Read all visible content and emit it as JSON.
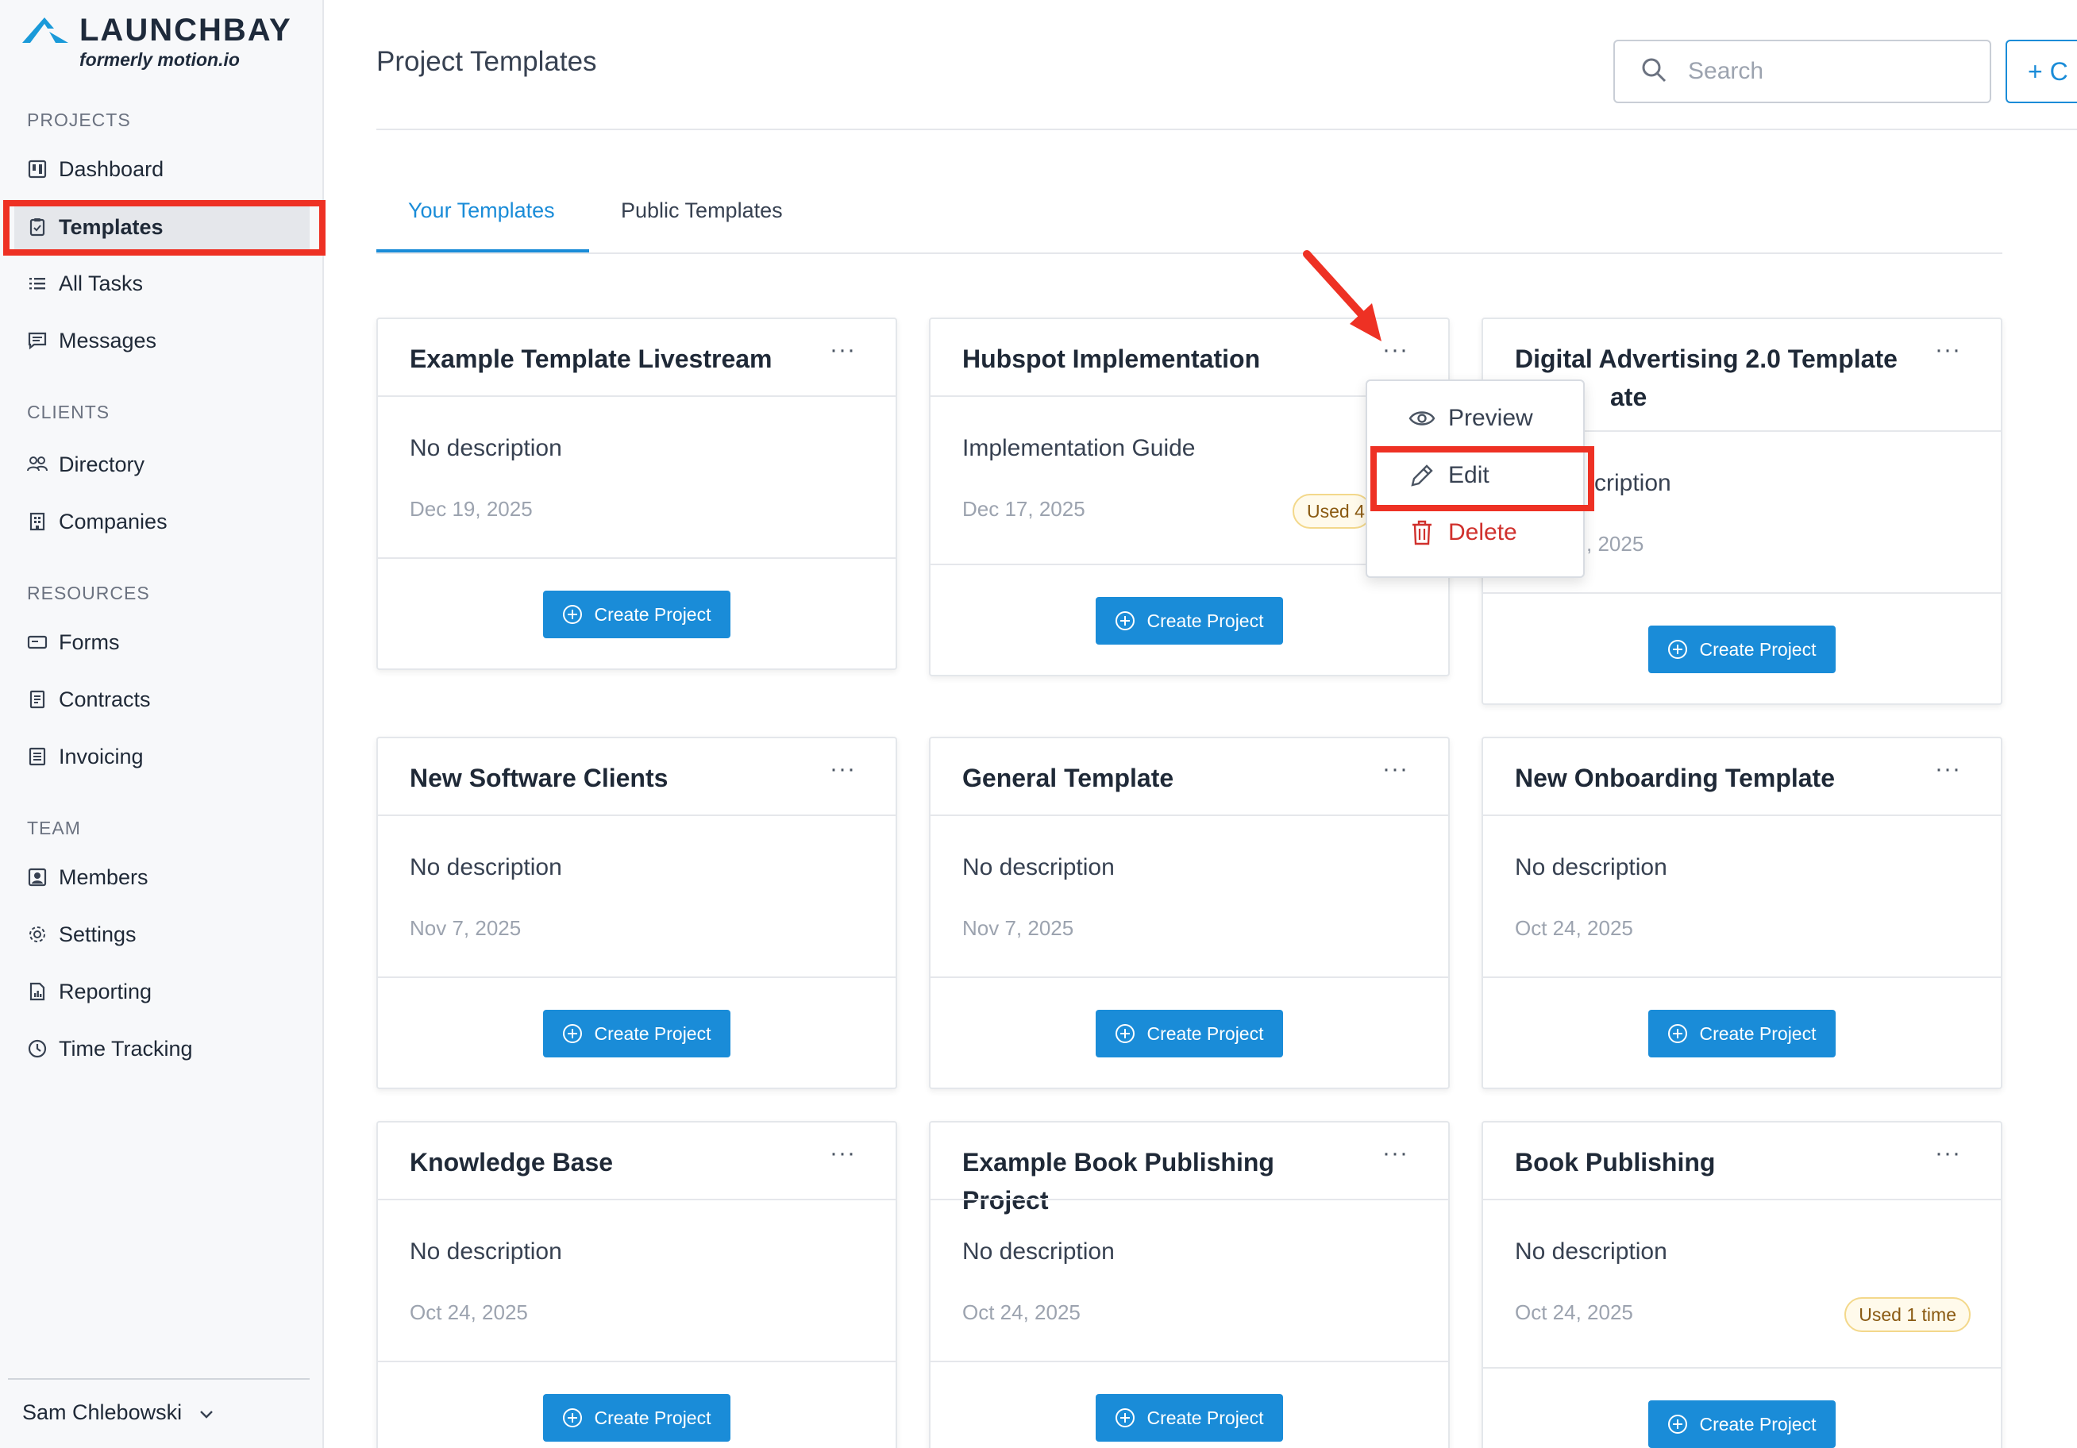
{
  "brand": {
    "name": "LAUNCHBAY",
    "tagline": "formerly motion.io",
    "color": "#1a8cd8"
  },
  "sidebar": {
    "sections": [
      {
        "label": "PROJECTS",
        "items": [
          {
            "label": "Dashboard",
            "icon": "dashboard-icon"
          },
          {
            "label": "Templates",
            "icon": "clipboard-icon",
            "active": true
          },
          {
            "label": "All Tasks",
            "icon": "list-icon"
          },
          {
            "label": "Messages",
            "icon": "message-icon"
          }
        ]
      },
      {
        "label": "CLIENTS",
        "items": [
          {
            "label": "Directory",
            "icon": "users-icon"
          },
          {
            "label": "Companies",
            "icon": "building-icon"
          }
        ]
      },
      {
        "label": "RESOURCES",
        "items": [
          {
            "label": "Forms",
            "icon": "form-icon"
          },
          {
            "label": "Contracts",
            "icon": "document-icon"
          },
          {
            "label": "Invoicing",
            "icon": "invoice-icon"
          }
        ]
      },
      {
        "label": "TEAM",
        "items": [
          {
            "label": "Members",
            "icon": "member-icon"
          },
          {
            "label": "Settings",
            "icon": "gear-icon"
          },
          {
            "label": "Reporting",
            "icon": "report-icon"
          },
          {
            "label": "Time Tracking",
            "icon": "clock-icon"
          }
        ]
      }
    ],
    "user": {
      "name": "Sam Chlebowski"
    }
  },
  "header": {
    "title": "Project Templates",
    "search_placeholder": "Search",
    "new_button_label": "+ C"
  },
  "tabs": [
    {
      "label": "Your Templates",
      "active": true
    },
    {
      "label": "Public Templates",
      "active": false
    }
  ],
  "templates": [
    {
      "title": "Example Template Livestream",
      "description": "No description",
      "date": "Dec 19, 2025",
      "badge": ""
    },
    {
      "title": "Hubspot Implementation",
      "description": "Implementation Guide",
      "date": "Dec 17, 2025",
      "badge": "Used 4 t"
    },
    {
      "title": "Digital Advertising 2.0 Template",
      "title_line2": "ate",
      "description": "cription",
      "date": ", 2025",
      "badge": ""
    },
    {
      "title": "New Software Clients",
      "description": "No description",
      "date": "Nov 7, 2025",
      "badge": ""
    },
    {
      "title": "General Template",
      "description": "No description",
      "date": "Nov 7, 2025",
      "badge": ""
    },
    {
      "title": "New Onboarding Template",
      "description": "No description",
      "date": "Oct 24, 2025",
      "badge": ""
    },
    {
      "title": "Knowledge Base",
      "description": "No description",
      "date": "Oct 24, 2025",
      "badge": ""
    },
    {
      "title": "Example Book Publishing Project",
      "description": "No description",
      "date": "Oct 24, 2025",
      "badge": ""
    },
    {
      "title": "Book Publishing",
      "description": "No description",
      "date": "Oct 24, 2025",
      "badge": "Used 1 time"
    }
  ],
  "card_menu_glyph": "···",
  "create_button_label": "Create Project",
  "dropdown": {
    "items": [
      {
        "label": "Preview",
        "icon": "eye-icon"
      },
      {
        "label": "Edit",
        "icon": "pencil-icon"
      },
      {
        "label": "Delete",
        "icon": "trash-icon"
      }
    ]
  },
  "colors": {
    "accent": "#1a8cd8",
    "highlight": "#ee3124",
    "danger": "#d0312d",
    "badge_bg": "#fffaeb"
  }
}
